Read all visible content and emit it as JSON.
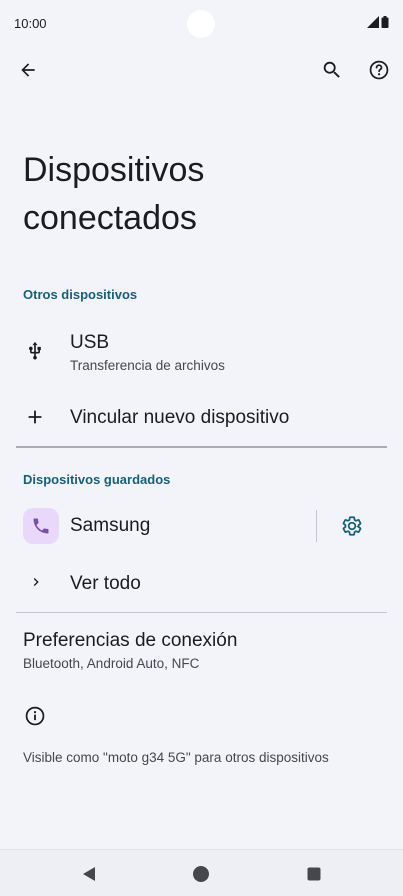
{
  "status_bar": {
    "time": "10:00"
  },
  "toolbar": {
    "back_icon": "arrow-back-icon",
    "search_icon": "search-icon",
    "help_icon": "help-icon"
  },
  "page": {
    "title": "Dispositivos conectados"
  },
  "sections": {
    "other": {
      "header": "Otros dispositivos",
      "usb": {
        "title": "USB",
        "subtitle": "Transferencia de archivos",
        "icon": "usb-icon"
      },
      "pair": {
        "title": "Vincular nuevo dispositivo",
        "icon": "plus-icon"
      }
    },
    "saved": {
      "header": "Dispositivos guardados",
      "samsung": {
        "title": "Samsung",
        "icon": "phone-icon",
        "settings_icon": "gear-icon"
      },
      "see_all": {
        "title": "Ver todo",
        "icon": "chevron-right-icon"
      }
    }
  },
  "preferences": {
    "title": "Preferencias de conexión",
    "subtitle": "Bluetooth, Android Auto, NFC"
  },
  "footer": {
    "info_icon": "info-icon",
    "visible_text": "Visible como \"moto g34 5G\" para otros dispositivos"
  },
  "colors": {
    "accent": "#18607a",
    "icon_bg": "#ead8fb",
    "phone_icon": "#7b4fa8",
    "background": "#f2f4fa"
  }
}
